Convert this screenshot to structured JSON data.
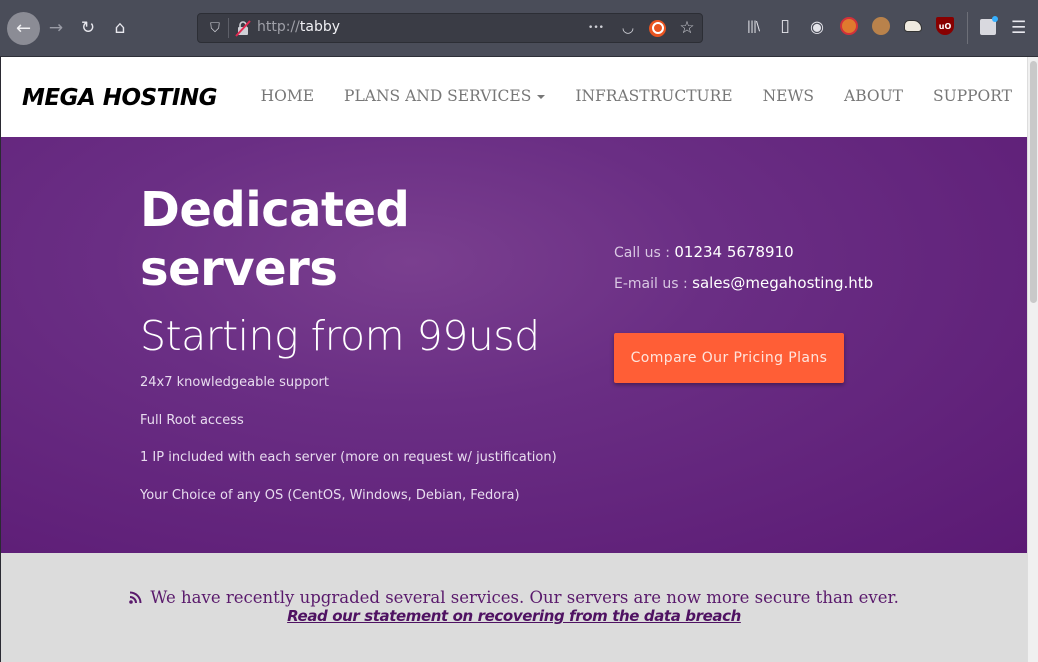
{
  "browser": {
    "url_protocol": "http://",
    "url_host": "tabby",
    "icons": {
      "back": "back-arrow-icon",
      "forward": "forward-arrow-icon",
      "reload": "reload-icon",
      "home": "home-icon",
      "tracking_protection": "shield-icon",
      "insecure": "insecure-lock-icon",
      "page_actions": "ellipsis-icon",
      "pocket": "pocket-icon",
      "ubuntu": "ubuntu-icon",
      "bookmark": "star-icon",
      "library": "library-icon",
      "sidebar": "sidebar-icon",
      "account": "account-icon",
      "extensions": [
        "no-cookie-extension-icon",
        "cookie-extension-icon",
        "shoe-extension-icon",
        "ublock-origin-icon"
      ],
      "whats_new": "gift-icon",
      "menu": "hamburger-menu-icon"
    },
    "glyphs": {
      "back": "←",
      "forward": "→",
      "reload": "↻",
      "home": "⌂",
      "shield": "⛉",
      "ellipsis": "•••",
      "pocket": "◡",
      "star": "☆",
      "library": "|||\\",
      "sidebar": "▯",
      "account": "◉",
      "ublock": "uO",
      "menu": "☰"
    }
  },
  "site": {
    "brand": "MEGA HOSTING",
    "nav": [
      {
        "label": "HOME"
      },
      {
        "label": "PLANS AND SERVICES",
        "dropdown": true
      },
      {
        "label": "INFRASTRUCTURE"
      },
      {
        "label": "NEWS"
      },
      {
        "label": "ABOUT"
      },
      {
        "label": "SUPPORT"
      }
    ]
  },
  "hero": {
    "title_line1": "Dedicated",
    "title_line2": "servers",
    "subtitle": "Starting from 99usd",
    "features": [
      "24x7 knowledgeable support",
      "Full Root access",
      "1 IP included with each server (more on request w/ justification)",
      "Your Choice of any OS (CentOS, Windows, Debian, Fedora)"
    ],
    "call_label": "Call us : ",
    "call_value": "01234 5678910",
    "email_label": "E-mail us : ",
    "email_value": "sales@megahosting.htb",
    "cta_label": "Compare Our Pricing Plans",
    "colors": {
      "background": "#5b1a74",
      "cta": "#ff5e36"
    }
  },
  "notice": {
    "icon": "rss-icon",
    "icon_glyph": "⦿",
    "text": "We have recently upgraded several services. Our servers are now more secure than ever.",
    "link": "Read our statement on recovering from the data breach"
  }
}
